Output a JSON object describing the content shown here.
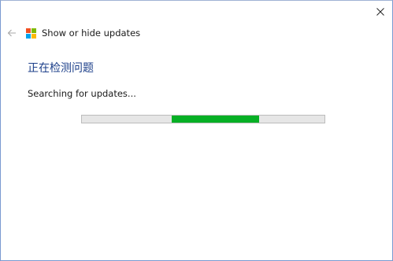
{
  "window": {
    "title": "Show or hide updates",
    "close_icon": "close-icon",
    "back_icon": "back-arrow-icon",
    "app_icon": "windows-logo-icon"
  },
  "main": {
    "heading": "正在检测问题",
    "status": "Searching for updates..."
  },
  "progress": {
    "mode": "indeterminate",
    "segment_start": 0.37,
    "segment_end": 0.73,
    "fill_color": "#06b025",
    "track_color": "#e6e6e6"
  },
  "colors": {
    "heading": "#1c3f8a",
    "logo": [
      "#f25022",
      "#7fba00",
      "#00a4ef",
      "#ffb900"
    ]
  }
}
